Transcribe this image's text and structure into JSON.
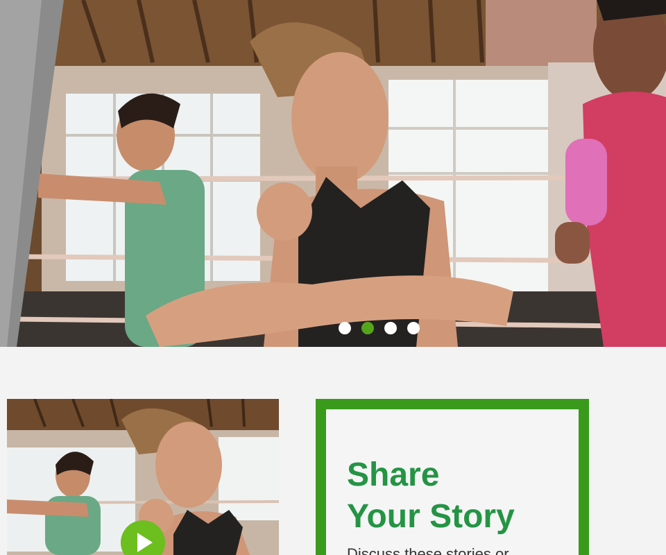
{
  "hero": {
    "carousel": {
      "slide_count": 4,
      "active_slide": 2
    }
  },
  "video": {
    "play_icon": "play-icon"
  },
  "story": {
    "title_line1": "Share",
    "title_line2": "Your Story",
    "description": "Discuss these stories or"
  },
  "colors": {
    "accent_green": "#3a9a1c",
    "title_green": "#249444",
    "play_green": "#6cbf1f",
    "dot_active": "#55a51c",
    "page_bg": "#f3f3f3"
  }
}
